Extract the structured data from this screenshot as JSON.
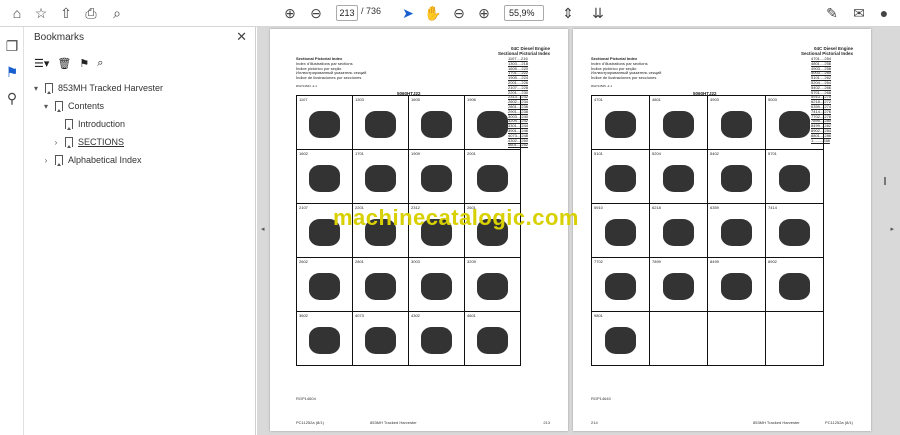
{
  "toolbar": {
    "page_current": "213",
    "page_total": "/ 736",
    "zoom": "55,9%"
  },
  "bookmarks": {
    "title": "Bookmarks",
    "items": [
      {
        "label": "853MH Tracked Harvester"
      },
      {
        "label": "Contents"
      },
      {
        "label": "Introduction"
      },
      {
        "label": "SECTIONS"
      },
      {
        "label": "Alphabetical Index"
      }
    ]
  },
  "watermark": "machinecatalogic.com",
  "page_left": {
    "header_right": [
      "04C Diesel Engine",
      "Sectional Pictorial Index"
    ],
    "header_left": [
      "Sectional Pictorial Index",
      "Index d'illustrations par sections",
      "Índice pictórico por seção",
      "Иллюстрированный указатель секций",
      "Índice de ilustraciones por secciones"
    ],
    "ref": "RGP14524 -4-1",
    "engine": "5060HTJ22",
    "index": [
      "1107....216",
      "1303....218",
      "1605....220",
      "1701....222",
      "1905....224",
      "2001....226",
      "2107....228",
      "2201....230",
      "2313....232",
      "2602....234",
      "2801....236",
      "2901....238",
      "3003....240",
      "3209....242",
      "3301....244",
      "3901....246",
      "4073....248",
      "4302....250",
      "4601....252"
    ],
    "cells": [
      "1107",
      "1303",
      "1605",
      "1906",
      "1602",
      "1701",
      "1909",
      "2001",
      "2107",
      "2201",
      "2312",
      "2601",
      "2602",
      "2801",
      "3003",
      "3209",
      "3602",
      "4073",
      "4302",
      "4601"
    ],
    "figure_ref": "RGP14604",
    "footer_left": "PC11252a (8/1)",
    "footer_mid": "853MH Tracked Harvester",
    "footer_page": "213"
  },
  "page_right": {
    "header_right": [
      "04C Diesel Engine",
      "Sectional Pictorial Index"
    ],
    "header_left": [
      "Sectional Pictorial Index",
      "Index d'illustrations par sections",
      "Índice pictórico por seção",
      "Иллюстрированный указатель секций",
      "Índice de ilustraciones por secciones"
    ],
    "ref": "RGP14525 -4-1",
    "engine": "5060HTJ22",
    "index": [
      "4701....254",
      "4801....256",
      "4903....258",
      "5003....260",
      "5101....262",
      "5204....264",
      "5402....266",
      "5701....268",
      "5910....270",
      "6218....272",
      "6359....274",
      "7414....276",
      "7702....278",
      "7899....280",
      "8499....282",
      "8902....284",
      "8801....286",
      "1.........288"
    ],
    "cells": [
      "4701",
      "4801",
      "4903",
      "5003",
      "5101",
      "5204",
      "5402",
      "5701",
      "5910",
      "6218",
      "6359",
      "7414",
      "7702",
      "7899",
      "8499",
      "8902",
      "9801",
      "",
      "",
      ""
    ],
    "figure_ref": "RGP14640",
    "footer_left": "214",
    "footer_mid": "853MH Tracked Harvester",
    "footer_page": "PC11252a (8/1)"
  }
}
